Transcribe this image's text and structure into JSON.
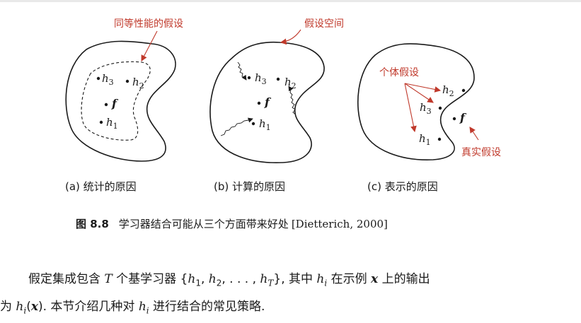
{
  "figure": {
    "panel_a": {
      "annotation": "同等性能的假设",
      "points": [
        {
          "id": "h3",
          "main": "h",
          "sub": "3"
        },
        {
          "id": "h2",
          "main": "h",
          "sub": "2"
        },
        {
          "id": "f",
          "main": "f",
          "sub": ""
        },
        {
          "id": "h1",
          "main": "h",
          "sub": "1"
        }
      ],
      "subcaption": "(a) 统计的原因"
    },
    "panel_b": {
      "annotation": "假设空间",
      "points": [
        {
          "id": "h3",
          "main": "h",
          "sub": "3"
        },
        {
          "id": "h2",
          "main": "h",
          "sub": "2"
        },
        {
          "id": "f",
          "main": "f",
          "sub": ""
        },
        {
          "id": "h1",
          "main": "h",
          "sub": "1"
        }
      ],
      "subcaption": "(b) 计算的原因"
    },
    "panel_c": {
      "annotation_individual": "个体假设",
      "annotation_true": "真实假设",
      "points": [
        {
          "id": "h2",
          "main": "h",
          "sub": "2"
        },
        {
          "id": "h3",
          "main": "h",
          "sub": "3"
        },
        {
          "id": "f",
          "main": "f",
          "sub": ""
        },
        {
          "id": "h1",
          "main": "h",
          "sub": "1"
        }
      ],
      "subcaption": "(c) 表示的原因"
    },
    "caption": {
      "number": "图 8.8",
      "text": "学习器结合可能从三个方面带来好处",
      "reference": "[Dietterich, 2000]"
    }
  },
  "body": {
    "line1": [
      {
        "t": "假定集成包含 ",
        "math": false
      },
      {
        "t": "T",
        "math": true
      },
      {
        "t": " 个基学习器 {",
        "math": false
      },
      {
        "t": "h",
        "math": true
      },
      {
        "t": "1",
        "math": false,
        "sub": true
      },
      {
        "t": ", ",
        "math": false
      },
      {
        "t": "h",
        "math": true
      },
      {
        "t": "2",
        "math": false,
        "sub": true
      },
      {
        "t": ", . . . , ",
        "math": false
      },
      {
        "t": "h",
        "math": true
      },
      {
        "t": "T",
        "math": true,
        "sub": true
      },
      {
        "t": "}, 其中 ",
        "math": false
      },
      {
        "t": "h",
        "math": true
      },
      {
        "t": "i",
        "math": true,
        "sub": true
      },
      {
        "t": " 在示例 ",
        "math": false
      },
      {
        "t": "x",
        "math": true,
        "bold": true
      },
      {
        "t": " 上的输出",
        "math": false
      }
    ],
    "line2": [
      {
        "t": "为 ",
        "math": false
      },
      {
        "t": "h",
        "math": true
      },
      {
        "t": "i",
        "math": true,
        "sub": true
      },
      {
        "t": "(",
        "math": false
      },
      {
        "t": "x",
        "math": true,
        "bold": true
      },
      {
        "t": "). 本节介绍几种对 ",
        "math": false
      },
      {
        "t": "h",
        "math": true
      },
      {
        "t": "i",
        "math": true,
        "sub": true
      },
      {
        "t": " 进行结合的常见策略.",
        "math": false
      }
    ]
  },
  "colors": {
    "annotation": "#c0392b",
    "text": "#1a1a1a"
  }
}
